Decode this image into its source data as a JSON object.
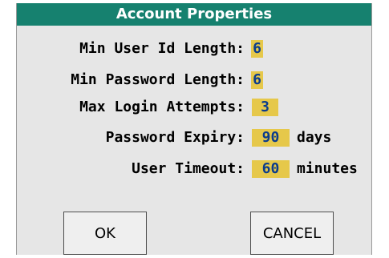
{
  "dialog": {
    "title": "Account Properties"
  },
  "fields": [
    {
      "label": "Min User Id Length:",
      "value": "6",
      "unit": ""
    },
    {
      "label": "Min Password Length:",
      "value": "6",
      "unit": ""
    },
    {
      "label": "Max Login Attempts:",
      "value": "3",
      "unit": ""
    },
    {
      "label": "Password Expiry:",
      "value": "90",
      "unit": "days"
    },
    {
      "label": "User Timeout:",
      "value": "60",
      "unit": "minutes"
    }
  ],
  "buttons": {
    "ok_label": "OK",
    "cancel_label": "CANCEL"
  },
  "colors": {
    "title_bar": "#16816f",
    "value_highlight": "#e6c84a",
    "value_text": "#0b3c8c",
    "panel_background": "#e6e6e6"
  }
}
